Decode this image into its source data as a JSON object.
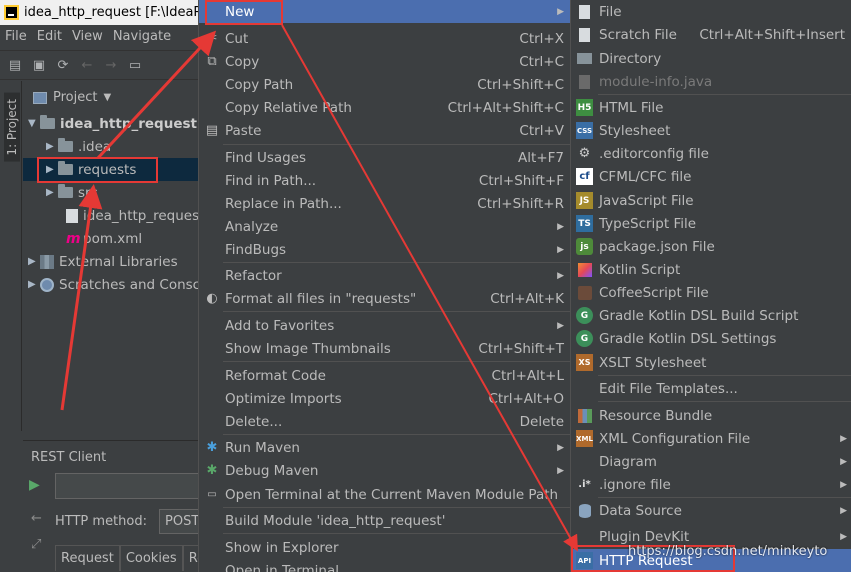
{
  "window": {
    "title": "idea_http_request [F:\\IdeaP"
  },
  "menubar": [
    "File",
    "Edit",
    "View",
    "Navigate"
  ],
  "sidebar_tab": "1: Project",
  "project_panel": {
    "header": "Project",
    "tree": [
      {
        "label": "idea_http_request",
        "suffix": "F",
        "bold": true
      },
      {
        "label": ".idea"
      },
      {
        "label": "requests"
      },
      {
        "label": "src"
      },
      {
        "label": "idea_http_reques"
      },
      {
        "label": "pom.xml"
      },
      {
        "label": "External Libraries"
      },
      {
        "label": "Scratches and Consc"
      }
    ]
  },
  "rest_client": {
    "title": "REST Client",
    "method_label": "HTTP method:",
    "method_value": "POST",
    "tabs": [
      "Request",
      "Cookies",
      "Res"
    ]
  },
  "context_menu": {
    "items": [
      {
        "label": "New",
        "shortcut": "",
        "submenu": true
      },
      {
        "label": "Cut",
        "shortcut": "Ctrl+X"
      },
      {
        "label": "Copy",
        "shortcut": "Ctrl+C"
      },
      {
        "label": "Copy Path",
        "shortcut": "Ctrl+Shift+C"
      },
      {
        "label": "Copy Relative Path",
        "shortcut": "Ctrl+Alt+Shift+C"
      },
      {
        "label": "Paste",
        "shortcut": "Ctrl+V"
      },
      {
        "label": "Find Usages",
        "shortcut": "Alt+F7"
      },
      {
        "label": "Find in Path...",
        "shortcut": "Ctrl+Shift+F"
      },
      {
        "label": "Replace in Path...",
        "shortcut": "Ctrl+Shift+R"
      },
      {
        "label": "Analyze",
        "shortcut": "",
        "submenu": true
      },
      {
        "label": "FindBugs",
        "shortcut": "",
        "submenu": true
      },
      {
        "label": "Refactor",
        "shortcut": "",
        "submenu": true
      },
      {
        "label": "Format all files in \"requests\"",
        "shortcut": "Ctrl+Alt+K"
      },
      {
        "label": "Add to Favorites",
        "shortcut": "",
        "submenu": true
      },
      {
        "label": "Show Image Thumbnails",
        "shortcut": "Ctrl+Shift+T"
      },
      {
        "label": "Reformat Code",
        "shortcut": "Ctrl+Alt+L"
      },
      {
        "label": "Optimize Imports",
        "shortcut": "Ctrl+Alt+O"
      },
      {
        "label": "Delete...",
        "shortcut": "Delete"
      },
      {
        "label": "Run Maven",
        "shortcut": "",
        "submenu": true
      },
      {
        "label": "Debug Maven",
        "shortcut": "",
        "submenu": true
      },
      {
        "label": "Open Terminal at the Current Maven Module Path",
        "shortcut": ""
      },
      {
        "label": "Build Module 'idea_http_request'",
        "shortcut": ""
      },
      {
        "label": "Show in Explorer",
        "shortcut": ""
      },
      {
        "label": "Open in Terminal",
        "shortcut": ""
      }
    ]
  },
  "new_submenu": {
    "items": [
      {
        "label": "File",
        "shortcut": "",
        "icon": "file-icon"
      },
      {
        "label": "Scratch File",
        "shortcut": "Ctrl+Alt+Shift+Insert",
        "icon": "scratch-file-icon"
      },
      {
        "label": "Directory",
        "shortcut": "",
        "icon": "folder-icon"
      },
      {
        "label": "module-info.java",
        "shortcut": "",
        "icon": "java-module-icon",
        "disabled": true
      },
      {
        "label": "HTML File",
        "shortcut": "",
        "icon": "html-icon",
        "badge": "H5"
      },
      {
        "label": "Stylesheet",
        "shortcut": "",
        "icon": "css-icon",
        "badge": "CSS"
      },
      {
        "label": ".editorconfig file",
        "shortcut": "",
        "icon": "editorconfig-icon"
      },
      {
        "label": "CFML/CFC file",
        "shortcut": "",
        "icon": "cfml-icon",
        "badge": "cf"
      },
      {
        "label": "JavaScript File",
        "shortcut": "",
        "icon": "javascript-icon",
        "badge": "JS"
      },
      {
        "label": "TypeScript File",
        "shortcut": "",
        "icon": "typescript-icon",
        "badge": "TS"
      },
      {
        "label": "package.json File",
        "shortcut": "",
        "icon": "nodejs-icon",
        "badge": "js"
      },
      {
        "label": "Kotlin Script",
        "shortcut": "",
        "icon": "kotlin-icon"
      },
      {
        "label": "CoffeeScript File",
        "shortcut": "",
        "icon": "coffeescript-icon"
      },
      {
        "label": "Gradle Kotlin DSL Build Script",
        "shortcut": "",
        "icon": "gradle-icon",
        "badge": "G"
      },
      {
        "label": "Gradle Kotlin DSL Settings",
        "shortcut": "",
        "icon": "gradle-icon",
        "badge": "G"
      },
      {
        "label": "XSLT Stylesheet",
        "shortcut": "",
        "icon": "xslt-icon",
        "badge": "XS"
      },
      {
        "label": "Edit File Templates...",
        "shortcut": ""
      },
      {
        "label": "Resource Bundle",
        "shortcut": "",
        "icon": "resource-bundle-icon"
      },
      {
        "label": "XML Configuration File",
        "shortcut": "",
        "icon": "xml-icon",
        "badge": "XML",
        "submenu": true
      },
      {
        "label": "Diagram",
        "shortcut": "",
        "submenu": true
      },
      {
        "label": ".ignore file",
        "shortcut": "",
        "icon": "ignore-icon",
        "badge": ".i*",
        "submenu": true
      },
      {
        "label": "Data Source",
        "shortcut": "",
        "icon": "database-icon",
        "submenu": true
      },
      {
        "label": "Plugin DevKit",
        "shortcut": "",
        "submenu": true
      },
      {
        "label": "HTTP Request",
        "shortcut": "",
        "icon": "api-icon",
        "badge": "API"
      }
    ]
  },
  "watermark": "https://blog.csdn.net/minkeyto",
  "colors": {
    "selection": "#4b6eaf",
    "annotation_red": "#e53935",
    "background": "#3c3f41"
  }
}
